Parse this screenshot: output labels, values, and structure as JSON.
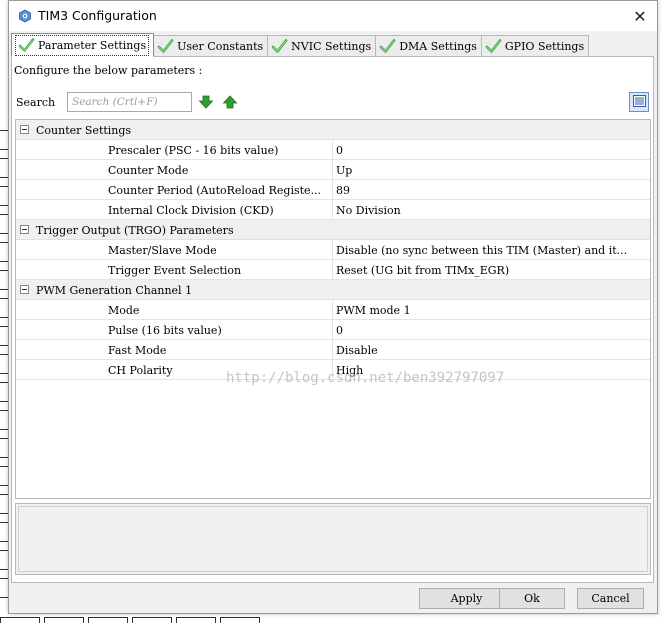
{
  "window": {
    "title": "TIM3 Configuration",
    "app_icon": "cube-settings-icon",
    "close_icon": "close-icon",
    "close_glyph": "✕"
  },
  "tabs": [
    {
      "label": "Parameter Settings",
      "icon": "green-check-icon",
      "active": true
    },
    {
      "label": "User Constants",
      "icon": "green-check-icon",
      "active": false
    },
    {
      "label": "NVIC Settings",
      "icon": "green-check-icon",
      "active": false
    },
    {
      "label": "DMA Settings",
      "icon": "green-check-icon",
      "active": false
    },
    {
      "label": "GPIO Settings",
      "icon": "green-check-icon",
      "active": false
    }
  ],
  "parameters": {
    "instruction": "Configure the below parameters :",
    "search": {
      "label": "Search",
      "placeholder": "Search (Crtl+F)",
      "value": ""
    },
    "arrow_down_icon": "green-down-arrow-icon",
    "arrow_up_icon": "green-up-arrow-icon",
    "view_toggle_icon": "list-view-icon"
  },
  "groups": [
    {
      "label": "Counter Settings",
      "rows": [
        {
          "name": "Prescaler (PSC - 16 bits value)",
          "value": "0"
        },
        {
          "name": "Counter Mode",
          "value": "Up"
        },
        {
          "name": "Counter Period (AutoReload Registe...",
          "value": "89"
        },
        {
          "name": "Internal Clock Division (CKD)",
          "value": "No Division"
        }
      ]
    },
    {
      "label": "Trigger Output (TRGO) Parameters",
      "rows": [
        {
          "name": "Master/Slave Mode",
          "value": "Disable (no sync between this TIM (Master) and it..."
        },
        {
          "name": "Trigger Event Selection",
          "value": "Reset (UG bit from TIMx_EGR)"
        }
      ]
    },
    {
      "label": "PWM Generation Channel 1",
      "rows": [
        {
          "name": "Mode",
          "value": "PWM mode 1"
        },
        {
          "name": "Pulse (16 bits value)",
          "value": "0"
        },
        {
          "name": "Fast Mode",
          "value": "Disable"
        },
        {
          "name": "CH Polarity",
          "value": "High"
        }
      ]
    }
  ],
  "watermark": "http://blog.csdn.net/ben392797097",
  "buttons": {
    "apply": "Apply",
    "ok": "Ok",
    "cancel": "Cancel"
  },
  "colors": {
    "check_green": "#3aa83a",
    "arrow_green": "#2e9e2e",
    "group_bg": "#f0f0f0",
    "selection_blue": "#dbe8fb"
  }
}
